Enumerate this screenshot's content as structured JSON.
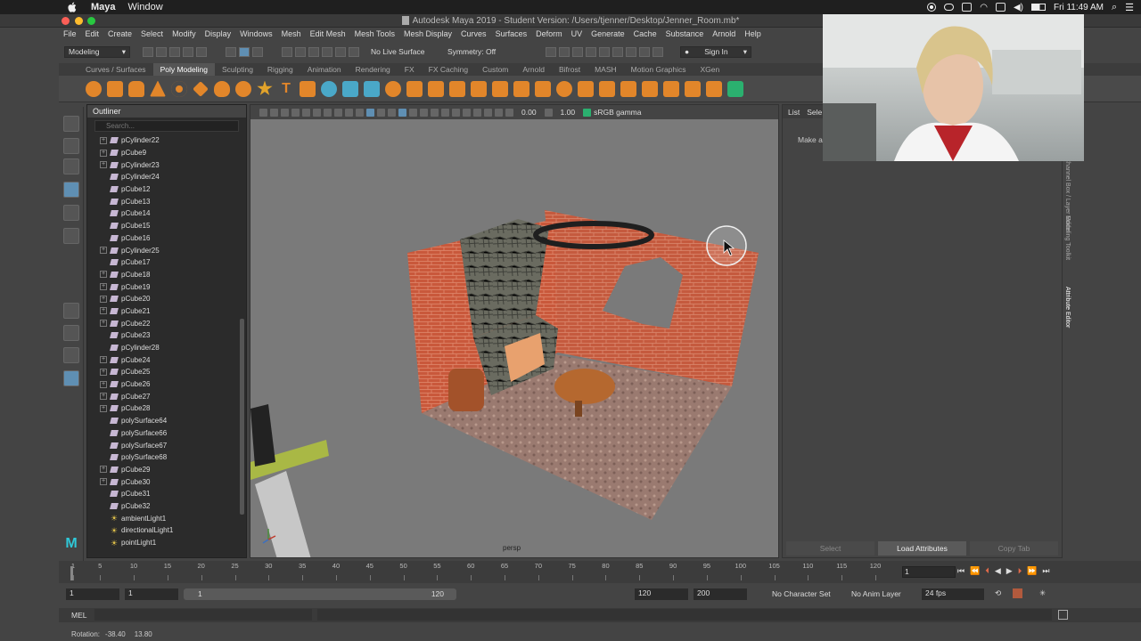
{
  "macos_menubar": {
    "app": "Maya",
    "menu": "Window",
    "clock": "Fri 11:49 AM"
  },
  "window_title": "Autodesk Maya 2019 - Student Version: /Users/tjenner/Desktop/Jenner_Room.mb*",
  "main_menu": [
    "File",
    "Edit",
    "Create",
    "Select",
    "Modify",
    "Display",
    "Windows",
    "Mesh",
    "Edit Mesh",
    "Mesh Tools",
    "Mesh Display",
    "Curves",
    "Surfaces",
    "Deform",
    "UV",
    "Generate",
    "Cache",
    "Substance",
    "Arnold",
    "Help"
  ],
  "status_line": {
    "menuset": "Modeling",
    "live_surface": "No Live Surface",
    "symmetry": "Symmetry: Off",
    "sign_in": "Sign In"
  },
  "shelf_tabs": [
    "Curves / Surfaces",
    "Poly Modeling",
    "Sculpting",
    "Rigging",
    "Animation",
    "Rendering",
    "FX",
    "FX Caching",
    "Custom",
    "Arnold",
    "Bifrost",
    "MASH",
    "Motion Graphics",
    "XGen"
  ],
  "shelf_active": "Poly Modeling",
  "outliner": {
    "title": "Outliner",
    "search_placeholder": "Search...",
    "items": [
      {
        "name": "pCylinder22",
        "expand": true,
        "kind": "mesh"
      },
      {
        "name": "pCube9",
        "expand": true,
        "kind": "mesh"
      },
      {
        "name": "pCylinder23",
        "expand": true,
        "kind": "mesh"
      },
      {
        "name": "pCylinder24",
        "expand": false,
        "kind": "mesh"
      },
      {
        "name": "pCube12",
        "expand": false,
        "kind": "mesh"
      },
      {
        "name": "pCube13",
        "expand": false,
        "kind": "mesh"
      },
      {
        "name": "pCube14",
        "expand": false,
        "kind": "mesh"
      },
      {
        "name": "pCube15",
        "expand": false,
        "kind": "mesh"
      },
      {
        "name": "pCube16",
        "expand": false,
        "kind": "mesh"
      },
      {
        "name": "pCylinder25",
        "expand": true,
        "kind": "mesh"
      },
      {
        "name": "pCube17",
        "expand": false,
        "kind": "mesh"
      },
      {
        "name": "pCube18",
        "expand": true,
        "kind": "mesh"
      },
      {
        "name": "pCube19",
        "expand": true,
        "kind": "mesh"
      },
      {
        "name": "pCube20",
        "expand": true,
        "kind": "mesh"
      },
      {
        "name": "pCube21",
        "expand": true,
        "kind": "mesh"
      },
      {
        "name": "pCube22",
        "expand": true,
        "kind": "mesh"
      },
      {
        "name": "pCube23",
        "expand": false,
        "kind": "mesh"
      },
      {
        "name": "pCylinder28",
        "expand": false,
        "kind": "mesh"
      },
      {
        "name": "pCube24",
        "expand": true,
        "kind": "mesh"
      },
      {
        "name": "pCube25",
        "expand": true,
        "kind": "mesh"
      },
      {
        "name": "pCube26",
        "expand": true,
        "kind": "mesh"
      },
      {
        "name": "pCube27",
        "expand": true,
        "kind": "mesh"
      },
      {
        "name": "pCube28",
        "expand": true,
        "kind": "mesh"
      },
      {
        "name": "polySurface64",
        "expand": false,
        "kind": "mesh"
      },
      {
        "name": "polySurface66",
        "expand": false,
        "kind": "mesh"
      },
      {
        "name": "polySurface67",
        "expand": false,
        "kind": "mesh"
      },
      {
        "name": "polySurface68",
        "expand": false,
        "kind": "mesh"
      },
      {
        "name": "pCube29",
        "expand": true,
        "kind": "mesh"
      },
      {
        "name": "pCube30",
        "expand": true,
        "kind": "mesh"
      },
      {
        "name": "pCube31",
        "expand": false,
        "kind": "mesh"
      },
      {
        "name": "pCube32",
        "expand": false,
        "kind": "mesh"
      },
      {
        "name": "ambientLight1",
        "expand": false,
        "kind": "light"
      },
      {
        "name": "directionalLight1",
        "expand": false,
        "kind": "light"
      },
      {
        "name": "pointLight1",
        "expand": false,
        "kind": "light"
      }
    ]
  },
  "viewport": {
    "gamma_value1": "0.00",
    "gamma_value2": "1.00",
    "color_space": "sRGB gamma",
    "camera": "persp"
  },
  "attribute_editor": {
    "tab_list": "List",
    "tab_selected": "Sele",
    "hint": "Make a",
    "buttons": [
      "Select",
      "Load Attributes",
      "Copy Tab"
    ]
  },
  "side_tabs": [
    "Channel Box / Layer Editor",
    "Modeling Toolkit",
    "Attribute Editor"
  ],
  "timeline": {
    "ticks": [
      "1",
      "5",
      "10",
      "15",
      "20",
      "25",
      "30",
      "35",
      "40",
      "45",
      "50",
      "55",
      "60",
      "65",
      "70",
      "75",
      "80",
      "85",
      "90",
      "95",
      "100",
      "105",
      "110",
      "115",
      "120"
    ],
    "current_frame": "1"
  },
  "range": {
    "start": "1",
    "playback_start": "1",
    "slider_start": "1",
    "slider_end": "120",
    "playback_end": "120",
    "end": "200",
    "character_set": "No Character Set",
    "anim_layer": "No Anim Layer",
    "fps": "24 fps"
  },
  "command_line": {
    "label": "MEL"
  },
  "help_line": {
    "label": "Rotation:",
    "x": "-38.40",
    "y": "13.80"
  }
}
